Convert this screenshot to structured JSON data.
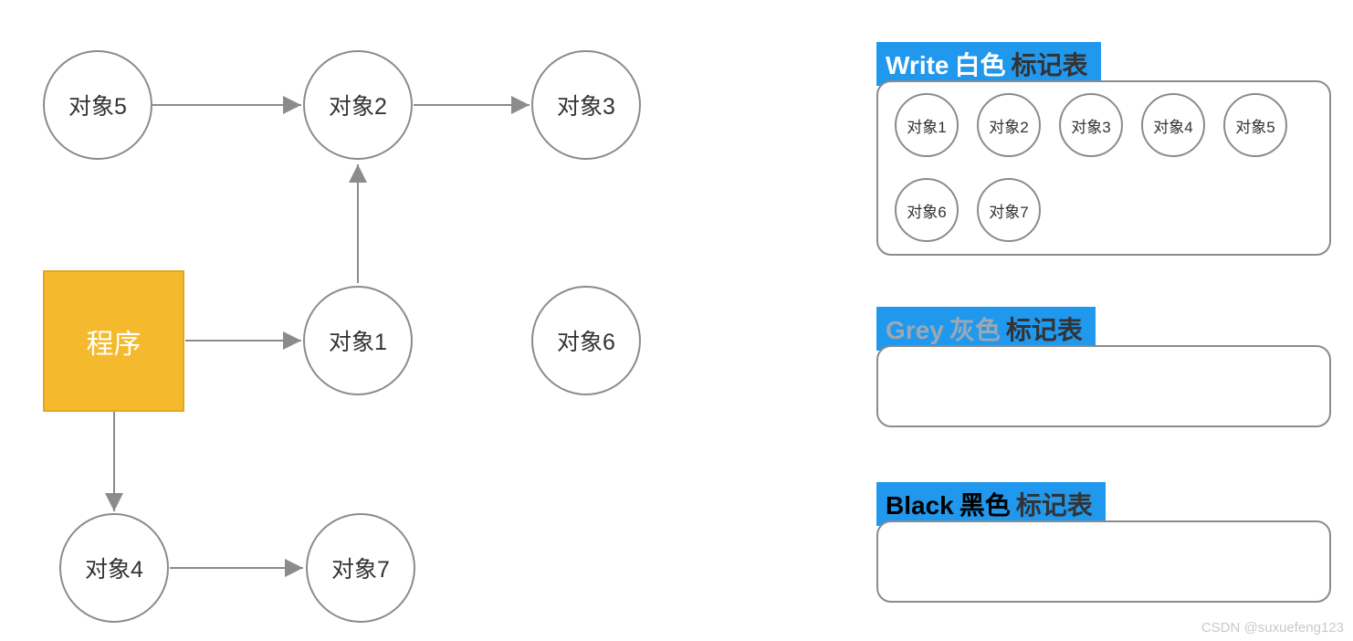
{
  "program": {
    "label": "程序"
  },
  "objects": {
    "o1": "对象1",
    "o2": "对象2",
    "o3": "对象3",
    "o4": "对象4",
    "o5": "对象5",
    "o6": "对象6",
    "o7": "对象7"
  },
  "panels": {
    "white": {
      "title1": "Write",
      "title2": "白色",
      "title3": "标记表",
      "items": [
        "对象1",
        "对象2",
        "对象3",
        "对象4",
        "对象5",
        "对象6",
        "对象7"
      ]
    },
    "grey": {
      "title1": "Grey",
      "title2": "灰色",
      "title3": "标记表",
      "items": []
    },
    "black": {
      "title1": "Black",
      "title2": "黑色",
      "title3": "标记表",
      "items": []
    }
  },
  "edges": [
    {
      "from": "program",
      "to": "o1"
    },
    {
      "from": "program",
      "to": "o4"
    },
    {
      "from": "o5",
      "to": "o2"
    },
    {
      "from": "o1",
      "to": "o2"
    },
    {
      "from": "o2",
      "to": "o3"
    },
    {
      "from": "o4",
      "to": "o7"
    }
  ],
  "watermark": "CSDN @suxuefeng123"
}
